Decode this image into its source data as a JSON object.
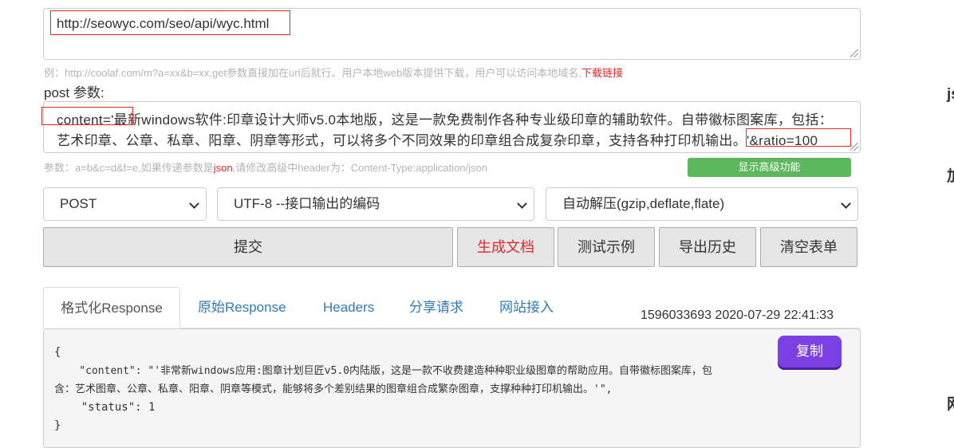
{
  "url_field": {
    "value": "http://seowyc.com/seo/api/wyc.html"
  },
  "url_hint": {
    "text": "例：http://coolaf.com/m?a=xx&b=xx,get参数直接加在url后就行。用户本地web版本提供下载，用户可以访问本地域名,",
    "link": "下载链接"
  },
  "post_label": "post 参数:",
  "post_field": {
    "line1": "content='最新windows软件:印章设计大师v5.0本地版，这是一款免费制作各种专业级印章的辅助软件。自带徽标图案库，包括：",
    "line2": "艺术印章、公章、私章、阳章、阴章等形式，可以将多个不同效果的印章组合成复杂印章，支持各种打印机输出。'&ratio=100"
  },
  "post_hint": {
    "before": "参数：a=b&c=d&f=e,如果传递参数是",
    "json_word": "json",
    "after": ",请修改高级中header为：Content-Type:application/json"
  },
  "advanced_button": "显示高级功能",
  "selects": {
    "method": "POST",
    "encoding": "UTF-8 --接口输出的编码",
    "decompress": "自动解压(gzip,deflate,flate)"
  },
  "buttons": {
    "submit": "提交",
    "gen_doc": "生成文档",
    "test_example": "测试示例",
    "export_history": "导出历史",
    "clear_form": "清空表单"
  },
  "tabs": [
    "格式化Response",
    "原始Response",
    "Headers",
    "分享请求",
    "网站接入"
  ],
  "timestamp": "1596033693 2020-07-29 22:41:33",
  "copy_button": "复制",
  "response_lines": [
    "{",
    "    \"content\": \"'非常新windows应用:图章计划巨匠v5.0内陆版，这是一款不收费建造种种职业级图章的帮助应用。自带徽标图案库，包",
    "含：艺术图章、公章、私章、阳章、阴章等模式，能够将多个差别结果的图章组合成繁杂图章，支撑种种打印机输出。'\",",
    "    \"status\": 1",
    "}"
  ],
  "edge_chars": [
    "js",
    "加",
    "网"
  ],
  "colors": {
    "accent_red": "#e0292b",
    "green": "#5cb85c",
    "purple": "#7b3fe4",
    "link_blue": "#337ab7"
  }
}
